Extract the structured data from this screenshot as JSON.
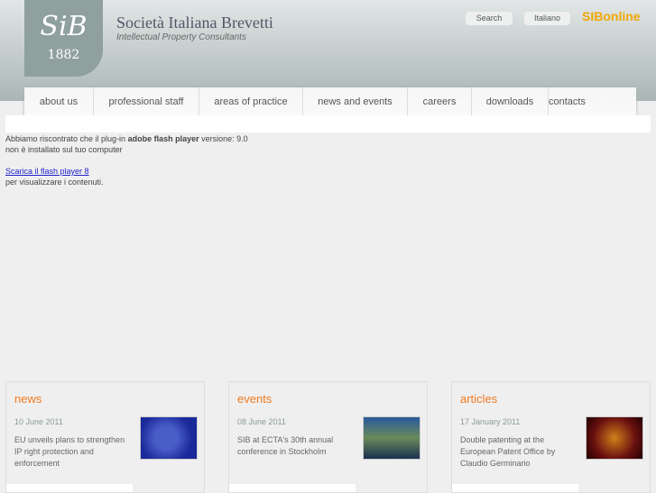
{
  "header": {
    "logo": "SiB",
    "year": "1882",
    "title": "Società Italiana Brevetti",
    "subtitle": "Intellectual Property Consultants",
    "search": "Search",
    "language": "Italiano",
    "online": "SIBonline"
  },
  "nav": [
    "about us",
    "professional staff",
    "areas of practice",
    "news and events",
    "careers",
    "downloads",
    "contacts"
  ],
  "flash": {
    "line1_pre": "Abbiamo riscontrato che il plug-in ",
    "line1_bold": "adobe flash player",
    "line1_post": " versione: 9.0",
    "line2": "non è installato sul tuo computer",
    "link": "Scarica il flash player 8",
    "line3": "per visualizzare i contenuti."
  },
  "cards": [
    {
      "title": "news",
      "date": "10 June 2011",
      "text": "EU unveils plans to strengthen IP right protection and enforcement"
    },
    {
      "title": "events",
      "date": "08 June 2011",
      "text": "SIB at ECTA's 30th annual conference in Stockholm"
    },
    {
      "title": "articles",
      "date": "17 January 2011",
      "text": "Double patenting at the European Patent Office by Claudio Germinario"
    }
  ]
}
